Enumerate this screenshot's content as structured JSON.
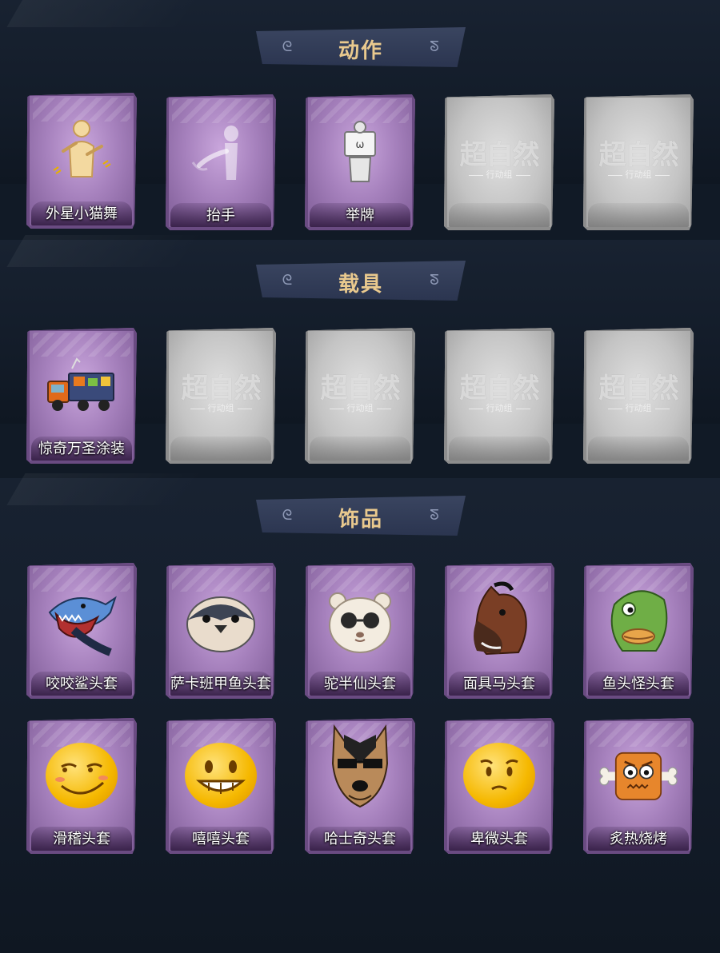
{
  "sections": [
    {
      "title": "动作",
      "items": [
        {
          "label": "外星小猫舞",
          "locked": false,
          "icon": "dance-pose-icon"
        },
        {
          "label": "抬手",
          "locked": false,
          "icon": "raise-hand-icon"
        },
        {
          "label": "举牌",
          "locked": false,
          "icon": "hold-sign-icon"
        },
        {
          "label": "",
          "locked": true,
          "icon": "placeholder-logo-icon"
        },
        {
          "label": "",
          "locked": true,
          "icon": "placeholder-logo-icon"
        }
      ]
    },
    {
      "title": "载具",
      "items": [
        {
          "label": "惊奇万圣涂装",
          "locked": false,
          "icon": "halloween-truck-icon"
        },
        {
          "label": "",
          "locked": true,
          "icon": "placeholder-logo-icon"
        },
        {
          "label": "",
          "locked": true,
          "icon": "placeholder-logo-icon"
        },
        {
          "label": "",
          "locked": true,
          "icon": "placeholder-logo-icon"
        },
        {
          "label": "",
          "locked": true,
          "icon": "placeholder-logo-icon"
        }
      ]
    },
    {
      "title": "饰品",
      "items": [
        {
          "label": "咬咬鲨头套",
          "locked": false,
          "icon": "shark-head-icon"
        },
        {
          "label": "萨卡班甲鱼头套",
          "locked": false,
          "icon": "fish-head-icon"
        },
        {
          "label": "驼半仙头套",
          "locked": false,
          "icon": "bear-sunglasses-icon"
        },
        {
          "label": "面具马头套",
          "locked": false,
          "icon": "horse-head-icon"
        },
        {
          "label": "鱼头怪头套",
          "locked": false,
          "icon": "green-fish-head-icon"
        },
        {
          "label": "滑稽头套",
          "locked": false,
          "icon": "smirk-emoji-icon"
        },
        {
          "label": "嘻嘻头套",
          "locked": false,
          "icon": "grin-emoji-icon"
        },
        {
          "label": "哈士奇头套",
          "locked": false,
          "icon": "husky-head-icon"
        },
        {
          "label": "卑微头套",
          "locked": false,
          "icon": "pleading-emoji-icon"
        },
        {
          "label": "炙热烧烤",
          "locked": false,
          "icon": "roast-meat-icon"
        }
      ]
    }
  ],
  "watermark": {
    "main": "超自然",
    "sub": "行动组"
  },
  "colors": {
    "banner_text": "#e9c98e",
    "card_purple": "#a681bd",
    "card_grey": "#c4c4c4",
    "background": "#111a26"
  }
}
